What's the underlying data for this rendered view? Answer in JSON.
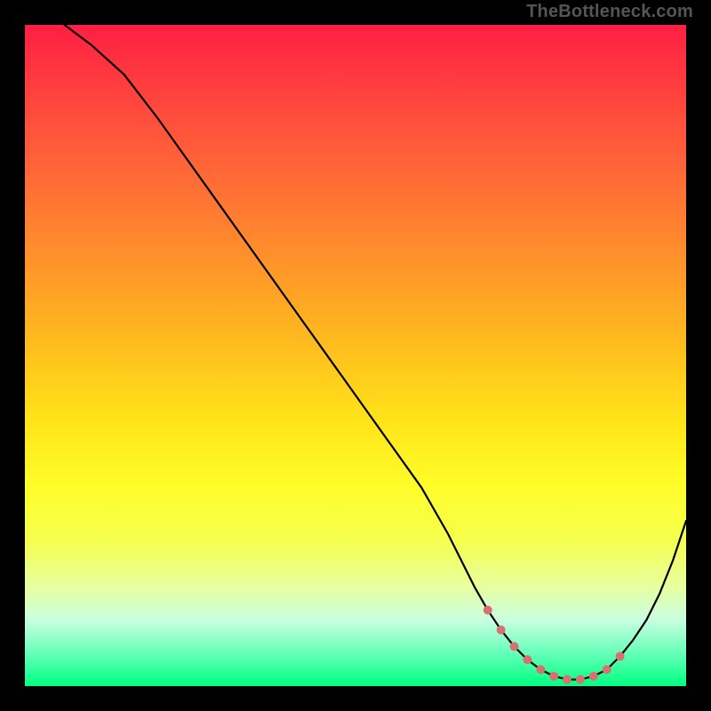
{
  "watermark": "TheBottleneck.com",
  "chart_data": {
    "type": "line",
    "title": "",
    "xlabel": "",
    "ylabel": "",
    "xlim": [
      0,
      100
    ],
    "ylim": [
      0,
      100
    ],
    "grid": false,
    "series": [
      {
        "name": "curve",
        "color": "#000000",
        "x": [
          6,
          10,
          15,
          20,
          25,
          30,
          35,
          40,
          45,
          50,
          55,
          60,
          64,
          66,
          68,
          70,
          72,
          74,
          76,
          78,
          80,
          82,
          84,
          86,
          88,
          90,
          92,
          94,
          96,
          98,
          100
        ],
        "y": [
          100,
          97,
          92.5,
          86,
          79,
          72,
          65,
          58,
          51,
          44,
          37,
          30,
          23,
          19,
          15,
          11.5,
          8.5,
          6,
          4,
          2.5,
          1.5,
          1,
          1,
          1.5,
          2.5,
          4.5,
          7,
          10,
          14,
          19,
          25
        ]
      }
    ],
    "markers": {
      "name": "flat-zone-dots",
      "color": "#d97070",
      "radius_px": 5,
      "x": [
        70,
        72,
        74,
        76,
        78,
        80,
        82,
        84,
        86,
        88,
        90
      ],
      "y": [
        11.5,
        8.5,
        6,
        4,
        2.5,
        1.5,
        1,
        1,
        1.5,
        2.5,
        4.5
      ]
    },
    "gradient_stops": [
      {
        "pos": 0.0,
        "color": "#ff1f43"
      },
      {
        "pos": 0.08,
        "color": "#ff3a3f"
      },
      {
        "pos": 0.18,
        "color": "#ff5a3a"
      },
      {
        "pos": 0.28,
        "color": "#ff7a32"
      },
      {
        "pos": 0.38,
        "color": "#ff9a28"
      },
      {
        "pos": 0.48,
        "color": "#ffbb1e"
      },
      {
        "pos": 0.6,
        "color": "#ffe419"
      },
      {
        "pos": 0.7,
        "color": "#fffd2a"
      },
      {
        "pos": 0.78,
        "color": "#f4ff4e"
      },
      {
        "pos": 0.85,
        "color": "#e8ffa0"
      },
      {
        "pos": 0.9,
        "color": "#c8ffe0"
      },
      {
        "pos": 0.95,
        "color": "#66ffb9"
      },
      {
        "pos": 1.0,
        "color": "#00ff80"
      }
    ]
  }
}
